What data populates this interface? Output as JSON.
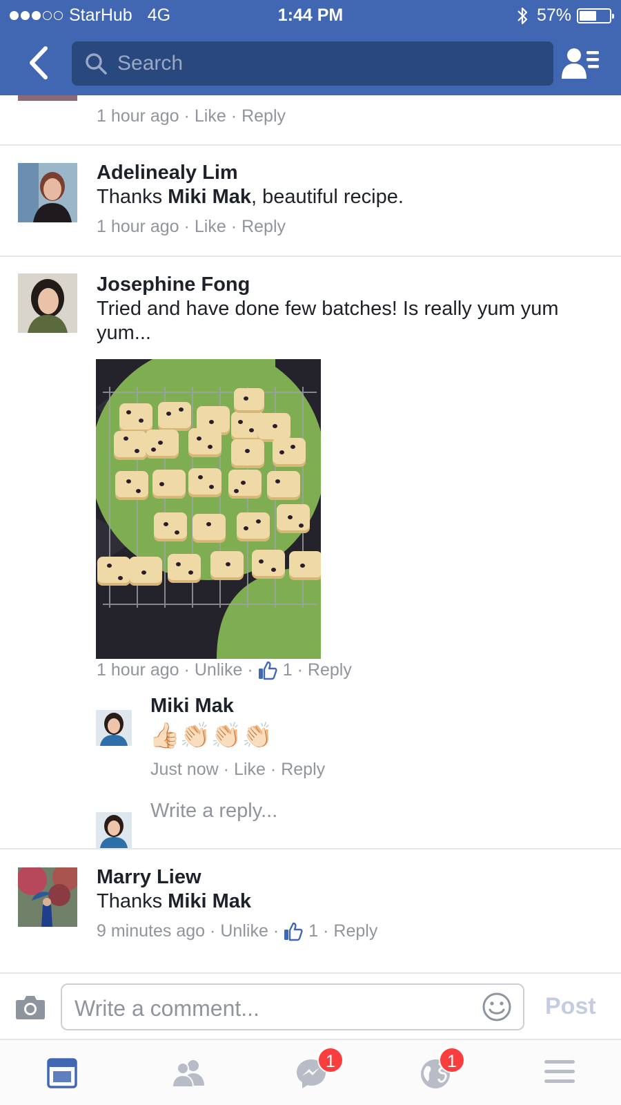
{
  "status_bar": {
    "carrier": "StarHub",
    "network": "4G",
    "time": "1:44 PM",
    "battery": "57%",
    "battery_level": 0.57,
    "signal_bars": 3
  },
  "header": {
    "search_placeholder": "Search",
    "color": "#4267b2"
  },
  "comments": [
    {
      "meta": {
        "time": "1 hour ago",
        "action": "Like",
        "reply": "Reply"
      }
    },
    {
      "author": "Adelinealy Lim",
      "text_before": "Thanks ",
      "mention": "Miki Mak",
      "text_after": ", beautiful recipe.",
      "meta": {
        "time": "1 hour ago",
        "action": "Like",
        "reply": "Reply"
      }
    },
    {
      "author": "Josephine Fong",
      "text": "Tried and have done few batches! Is really yum yum yum...",
      "meta": {
        "time": "1 hour ago",
        "action": "Unlike",
        "likes": "1",
        "reply": "Reply"
      },
      "reply": {
        "author": "Miki Mak",
        "emoji": "👍🏻👏🏻👏🏻👏🏻",
        "meta": {
          "time": "Just now",
          "action": "Like",
          "reply": "Reply"
        }
      },
      "reply_placeholder": "Write a reply..."
    },
    {
      "author": "Marry Liew",
      "text_before": "Thanks ",
      "mention": "Miki Mak",
      "meta": {
        "time": "9 minutes ago",
        "action": "Unlike",
        "likes": "1",
        "reply": "Reply"
      }
    }
  ],
  "composer": {
    "placeholder": "Write a comment...",
    "post_label": "Post"
  },
  "tabbar": {
    "tabs": [
      {
        "icon": "news-feed-icon",
        "badge": ""
      },
      {
        "icon": "friends-icon",
        "badge": ""
      },
      {
        "icon": "messenger-icon",
        "badge": "1"
      },
      {
        "icon": "globe-notifications-icon",
        "badge": "1"
      },
      {
        "icon": "menu-icon",
        "badge": ""
      }
    ],
    "active_color": "#4267b2",
    "inactive_color": "#b7bcc6"
  },
  "colors": {
    "meta_gray": "#90949c",
    "badge_red": "#fa3e3e",
    "like_blue": "#4267b2"
  }
}
